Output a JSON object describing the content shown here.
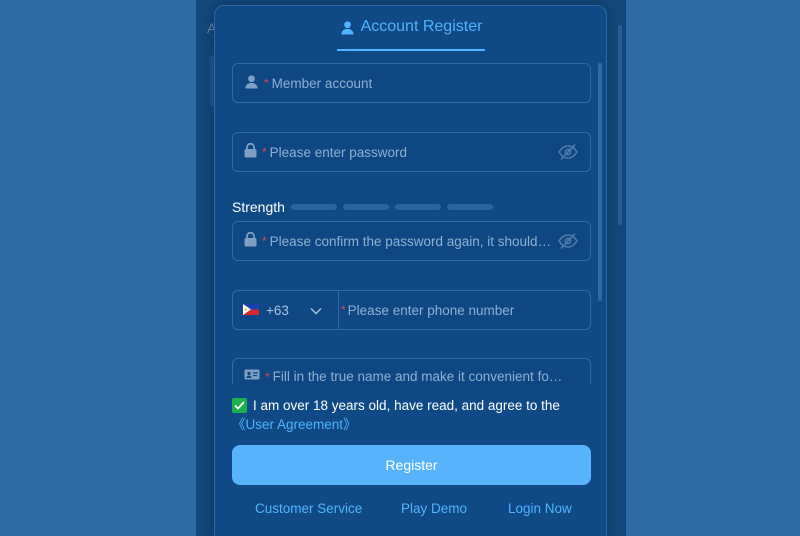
{
  "tab": {
    "label": "Account Register"
  },
  "fields": {
    "account": {
      "required": "*",
      "placeholder": "Member account"
    },
    "password": {
      "required": "*",
      "placeholder": "Please enter password"
    },
    "confirm": {
      "required": "*",
      "placeholder": "Please confirm the password again, it should be the same as the password"
    },
    "realname": {
      "required": "*",
      "placeholder": "Fill in the true name and make it convenient for later withdrawal"
    }
  },
  "strength": {
    "label": "Strength",
    "level": 0
  },
  "phone": {
    "country_code": "+63",
    "required": "*",
    "placeholder": "Please enter phone number"
  },
  "agreement": {
    "checked": true,
    "text": "I am over 18 years old, have read, and agree to the ",
    "link": "《User Agreement》"
  },
  "register_button": {
    "label": "Register"
  },
  "footer": {
    "customer_service": "Customer Service",
    "play_demo": "Play Demo",
    "login_now": "Login Now"
  },
  "backdrop": {
    "letter": "A"
  },
  "colors": {
    "accent": "#4fb3ff",
    "button": "#57b4fb",
    "check": "#19b24a",
    "required": "#e0454a"
  }
}
